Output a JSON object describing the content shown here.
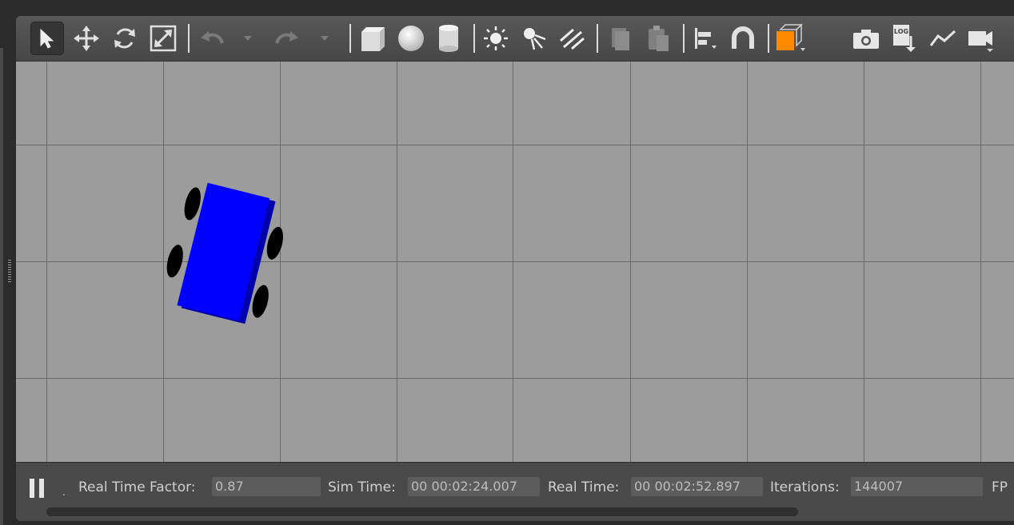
{
  "toolbar": {
    "tools": [
      {
        "name": "select-mode-icon",
        "active": true
      },
      {
        "name": "translate-mode-icon"
      },
      {
        "name": "rotate-mode-icon"
      },
      {
        "name": "scale-mode-icon"
      },
      {
        "name": "undo-icon"
      },
      {
        "name": "undo-history-dropdown-icon"
      },
      {
        "name": "redo-icon"
      },
      {
        "name": "redo-history-dropdown-icon"
      },
      {
        "name": "box-shape-icon"
      },
      {
        "name": "sphere-shape-icon"
      },
      {
        "name": "cylinder-shape-icon"
      },
      {
        "name": "point-light-icon"
      },
      {
        "name": "spot-light-icon"
      },
      {
        "name": "directional-light-icon"
      },
      {
        "name": "copy-icon"
      },
      {
        "name": "paste-icon"
      },
      {
        "name": "align-icon"
      },
      {
        "name": "snap-magnet-icon"
      },
      {
        "name": "view-angle-icon"
      },
      {
        "name": "screenshot-camera-icon"
      },
      {
        "name": "log-icon",
        "text": "LOG"
      },
      {
        "name": "plot-icon"
      },
      {
        "name": "video-record-icon"
      }
    ]
  },
  "viewport": {
    "background_color": "#9c9c9c",
    "robot_body_color": "#0000ff",
    "robot_wheel_color": "#000000"
  },
  "status": {
    "real_time_factor_label": "Real Time Factor:",
    "real_time_factor_value": "0.87",
    "sim_time_label": "Sim Time:",
    "sim_time_value": "00 00:02:24.007",
    "real_time_label": "Real Time:",
    "real_time_value": "00 00:02:52.897",
    "iterations_label": "Iterations:",
    "iterations_value": "144007",
    "fps_label": "FP"
  }
}
